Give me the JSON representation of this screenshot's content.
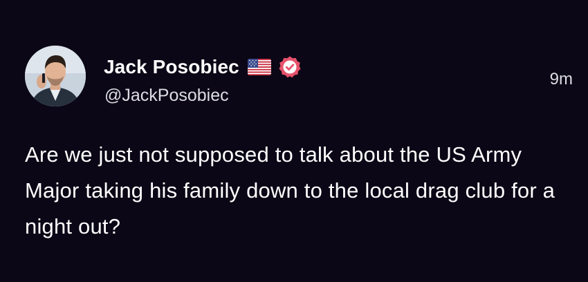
{
  "author": {
    "display_name": "Jack Posobiec",
    "handle": "@JackPosobiec",
    "flag_icon": "us-flag-icon",
    "verified_icon": "verified-badge-icon",
    "verified_color": "#e6526b"
  },
  "post": {
    "timestamp": "9m",
    "text": "Are we just not supposed to talk about the US Army Major taking his family down to the local drag club for a night out?"
  },
  "colors": {
    "background": "#0b0716",
    "text": "#ffffff",
    "secondary_text": "#dddde3"
  }
}
